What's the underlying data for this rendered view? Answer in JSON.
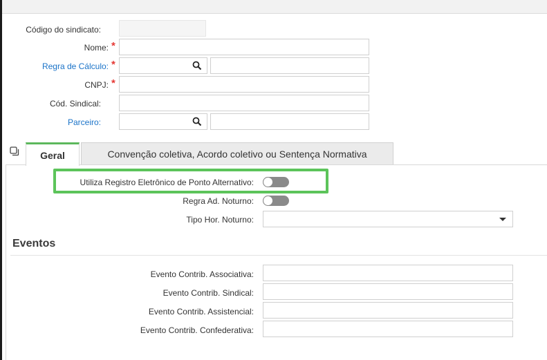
{
  "form": {
    "codigo_label": "Código do sindicato:",
    "nome_label": "Nome:",
    "regra_label": "Regra de Cálculo:",
    "cnpj_label": "CNPJ:",
    "cod_sindical_label": "Cód. Sindical:",
    "parceiro_label": "Parceiro:",
    "required_mark": "*",
    "nome_value": "",
    "regra_value": "",
    "regra_desc": "",
    "cnpj_value": "",
    "cod_sindical_value": "",
    "parceiro_value": "",
    "parceiro_desc": ""
  },
  "tabs": [
    {
      "label": "Geral",
      "active": true
    },
    {
      "label": "Convenção coletiva, Acordo coletivo ou Sentença Normativa",
      "active": false
    }
  ],
  "geral": {
    "rep_alternativo_label": "Utiliza Registro Eletrônico de Ponto Alternativo:",
    "rep_alternativo_on": false,
    "regra_noturno_label": "Regra Ad. Noturno:",
    "regra_noturno_on": false,
    "tipo_hor_label": "Tipo Hor. Noturno:",
    "tipo_hor_value": ""
  },
  "eventos": {
    "title": "Eventos",
    "fields": [
      {
        "label": "Evento Contrib. Associativa:",
        "value": ""
      },
      {
        "label": "Evento Contrib. Sindical:",
        "value": ""
      },
      {
        "label": "Evento Contrib. Assistencial:",
        "value": ""
      },
      {
        "label": "Evento Contrib. Confederativa:",
        "value": ""
      }
    ]
  },
  "colors": {
    "accent_green": "#5cc45a",
    "link_blue": "#1a73c8",
    "required_red": "#e53935"
  },
  "icons": [
    "search-icon",
    "copy-icon",
    "chevron-down-icon"
  ]
}
